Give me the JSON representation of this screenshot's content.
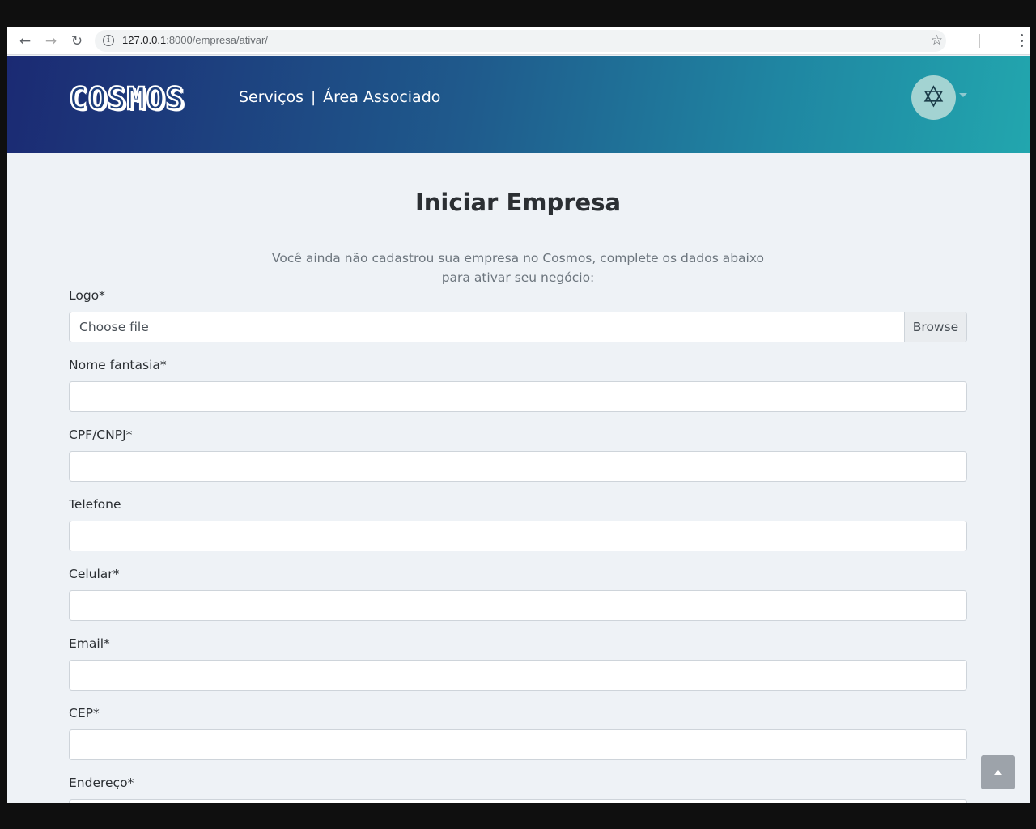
{
  "browser": {
    "url_host": "127.0.0.1",
    "url_path": ":8000/empresa/ativar/"
  },
  "header": {
    "logo_text": "COSMOS",
    "nav": [
      {
        "label": "Serviços"
      },
      {
        "label": "Área Associado"
      }
    ],
    "nav_separator": "|"
  },
  "main": {
    "title": "Iniciar Empresa",
    "intro": "Você ainda não cadastrou sua empresa no Cosmos, complete os dados abaixo para ativar seu negócio:",
    "logo_field": {
      "label": "Logo*",
      "placeholder": "Choose file",
      "browse_label": "Browse"
    },
    "fields": [
      {
        "label": "Nome fantasia*",
        "value": ""
      },
      {
        "label": "CPF/CNPJ*",
        "value": ""
      },
      {
        "label": "Telefone",
        "value": ""
      },
      {
        "label": "Celular*",
        "value": ""
      },
      {
        "label": "Email*",
        "value": ""
      },
      {
        "label": "CEP*",
        "value": ""
      },
      {
        "label": "Endereço*",
        "value": ""
      }
    ]
  },
  "colors": {
    "header_gradient_start": "#1b2a73",
    "header_gradient_end": "#22a6ae",
    "page_background": "#eef2f6",
    "text": "#2b2f33",
    "muted_text": "#6c757d"
  },
  "icons": [
    "back-arrow-icon",
    "forward-arrow-icon",
    "reload-icon",
    "info-icon",
    "star-icon",
    "kebab-menu-icon",
    "avatar-star-icon",
    "chevron-down-icon",
    "chevron-up-icon"
  ]
}
